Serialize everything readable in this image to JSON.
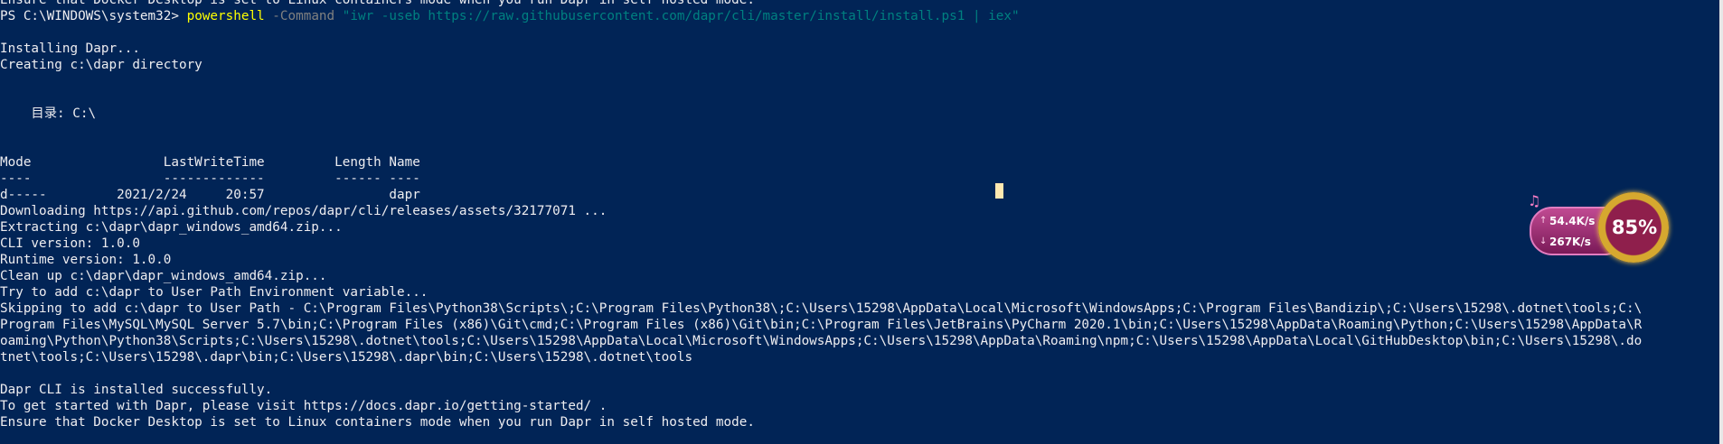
{
  "terminal": {
    "lines": [
      {
        "text": "Ensure that Docker Desktop is set to Linux containers mode when you run Dapr in self hosted mode."
      },
      {
        "segments": [
          {
            "text": "PS C:\\WINDOWS\\system32> ",
            "style": "plain"
          },
          {
            "text": "powershell",
            "style": "command"
          },
          {
            "text": " -Command ",
            "style": "parameter"
          },
          {
            "text": "\"iwr -useb https://raw.githubusercontent.com/dapr/cli/master/install/install.ps1 | iex\"",
            "style": "string"
          }
        ]
      },
      {
        "text": ""
      },
      {
        "text": "Installing Dapr..."
      },
      {
        "text": "Creating c:\\dapr directory"
      },
      {
        "text": ""
      },
      {
        "text": ""
      },
      {
        "text": "    目录: C:\\"
      },
      {
        "text": ""
      },
      {
        "text": ""
      },
      {
        "text": "Mode                 LastWriteTime         Length Name"
      },
      {
        "text": "----                 -------------         ------ ----"
      },
      {
        "text": "d-----         2021/2/24     20:57                dapr"
      },
      {
        "text": "Downloading https://api.github.com/repos/dapr/cli/releases/assets/32177071 ..."
      },
      {
        "text": "Extracting c:\\dapr\\dapr_windows_amd64.zip..."
      },
      {
        "text": "CLI version: 1.0.0"
      },
      {
        "text": "Runtime version: 1.0.0"
      },
      {
        "text": "Clean up c:\\dapr\\dapr_windows_amd64.zip..."
      },
      {
        "text": "Try to add c:\\dapr to User Path Environment variable..."
      },
      {
        "text": "Skipping to add c:\\dapr to User Path - C:\\Program Files\\Python38\\Scripts\\;C:\\Program Files\\Python38\\;C:\\Users\\15298\\AppData\\Local\\Microsoft\\WindowsApps;C:\\Program Files\\Bandizip\\;C:\\Users\\15298\\.dotnet\\tools;C:\\"
      },
      {
        "text": "Program Files\\MySQL\\MySQL Server 5.7\\bin;C:\\Program Files (x86)\\Git\\cmd;C:\\Program Files (x86)\\Git\\bin;C:\\Program Files\\JetBrains\\PyCharm 2020.1\\bin;C:\\Users\\15298\\AppData\\Roaming\\Python;C:\\Users\\15298\\AppData\\R"
      },
      {
        "text": "oaming\\Python\\Python38\\Scripts;C:\\Users\\15298\\.dotnet\\tools;C:\\Users\\15298\\AppData\\Local\\Microsoft\\WindowsApps;C:\\Users\\15298\\AppData\\Roaming\\npm;C:\\Users\\15298\\AppData\\Local\\GitHubDesktop\\bin;C:\\Users\\15298\\.do"
      },
      {
        "text": "tnet\\tools;C:\\Users\\15298\\.dapr\\bin;C:\\Users\\15298\\.dapr\\bin;C:\\Users\\15298\\.dotnet\\tools"
      },
      {
        "text": ""
      },
      {
        "text": "Dapr CLI is installed successfully."
      },
      {
        "text": "To get started with Dapr, please visit https://docs.dapr.io/getting-started/ ."
      },
      {
        "text": "Ensure that Docker Desktop is set to Linux containers mode when you run Dapr in self hosted mode."
      }
    ]
  },
  "network_widget": {
    "upload_rate": "54.4K/s",
    "download_rate": "267K/s",
    "usage_percent": "85%",
    "up_arrow": "↑",
    "down_arrow": "↓",
    "note_icon": "music-note-icon"
  },
  "colors": {
    "background": "#012456",
    "foreground": "#eeedf0",
    "command": "#ffff00",
    "parameter": "#808080",
    "string": "#008080"
  }
}
